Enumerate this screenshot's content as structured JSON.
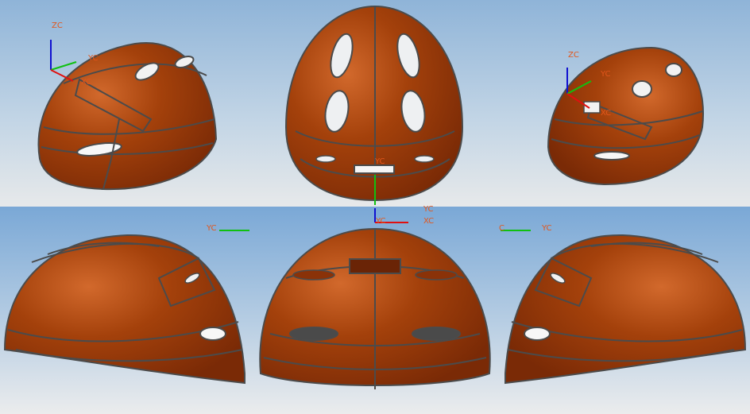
{
  "viewport": {
    "background": {
      "top_row": [
        "#8fb4d8",
        "#c4d6e6",
        "#e7e9ea"
      ],
      "bottom_row": [
        "#7aa8d6",
        "#b6cde3",
        "#ebeced"
      ]
    },
    "helmet_colors": {
      "base": "#7a2a06",
      "mid": "#a4410b",
      "highlight": "#d2692c",
      "edge": "#4b4b4b"
    },
    "axis_colors": {
      "x": "#e01010",
      "y": "#10c010",
      "z": "#1010d0"
    }
  },
  "views": [
    {
      "name": "iso-left",
      "triad": {
        "z": "ZC",
        "y": "YC",
        "x": "XC"
      }
    },
    {
      "name": "top",
      "triad": {
        "y": "YC"
      }
    },
    {
      "name": "iso-right",
      "triad": {
        "z": "ZC",
        "y": "YC",
        "x": "XC"
      }
    },
    {
      "name": "side-left",
      "triad": {
        "y": "YC"
      }
    },
    {
      "name": "front",
      "triad": {
        "top": "YC",
        "y": "YC",
        "x": "XC"
      }
    },
    {
      "name": "side-right",
      "triad": {
        "z": "C",
        "y": "YC"
      }
    }
  ]
}
